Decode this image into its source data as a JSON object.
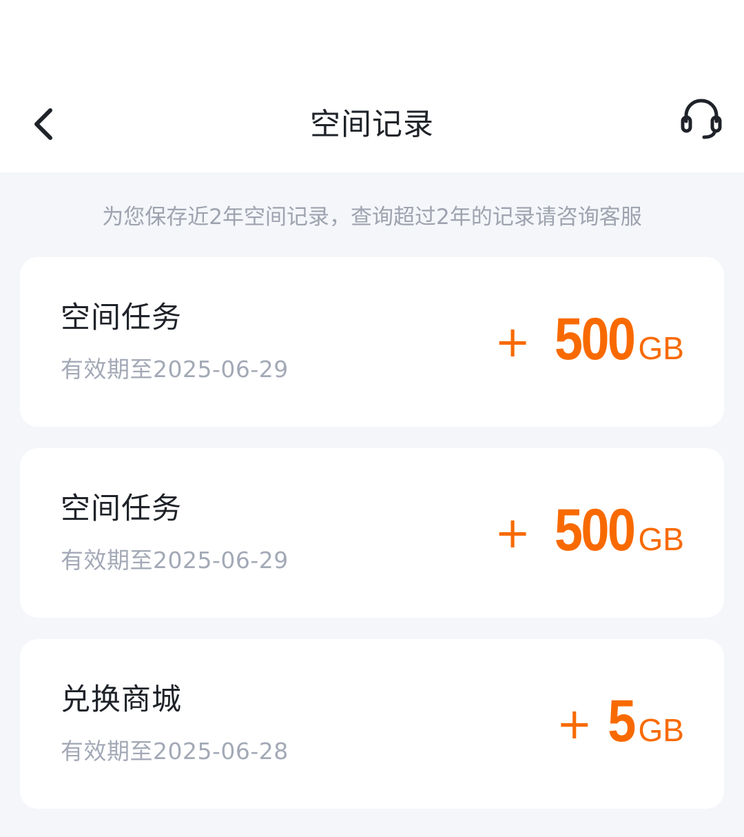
{
  "header": {
    "title": "空间记录",
    "back_icon": "chevron-left-icon",
    "support_icon": "headset-icon"
  },
  "notice": "为您保存近2年空间记录，查询超过2年的记录请咨询客服",
  "colors": {
    "accent": "#f86a00",
    "title_text": "#1f2329",
    "muted_text": "#a3a9b6",
    "background": "#f4f6fa"
  },
  "records": [
    {
      "title": "空间任务",
      "expiry": "有效期至2025-06-29",
      "sign": "+",
      "value": "500",
      "unit": "GB"
    },
    {
      "title": "空间任务",
      "expiry": "有效期至2025-06-29",
      "sign": "+",
      "value": "500",
      "unit": "GB"
    },
    {
      "title": "兑换商城",
      "expiry": "有效期至2025-06-28",
      "sign": "+",
      "value": "5",
      "unit": "GB"
    }
  ]
}
